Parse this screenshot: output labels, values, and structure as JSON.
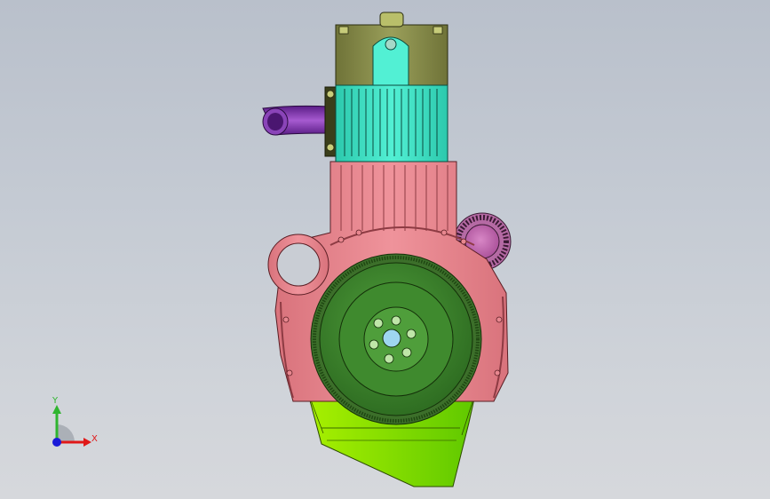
{
  "viewport": {
    "background_top": "#b9c0cb",
    "background_bottom": "#d6d8dc"
  },
  "model": {
    "parts": [
      {
        "name": "cylinder-head",
        "color": "#8a8f4e"
      },
      {
        "name": "cylinder-head-cover",
        "color": "#3fe6c8"
      },
      {
        "name": "cylinder-block",
        "color": "#e8878f"
      },
      {
        "name": "flywheel",
        "color": "#3f8a2e"
      },
      {
        "name": "oil-pan",
        "color": "#7de000"
      },
      {
        "name": "intake-pipe",
        "color": "#7a2fa8"
      },
      {
        "name": "gear-pulley",
        "color": "#c36bb0"
      }
    ]
  },
  "triad": {
    "y_label": "Y",
    "x_label": "X",
    "y_color": "#2fb52f",
    "x_color": "#e01818",
    "z_color": "#1a1ad8"
  }
}
